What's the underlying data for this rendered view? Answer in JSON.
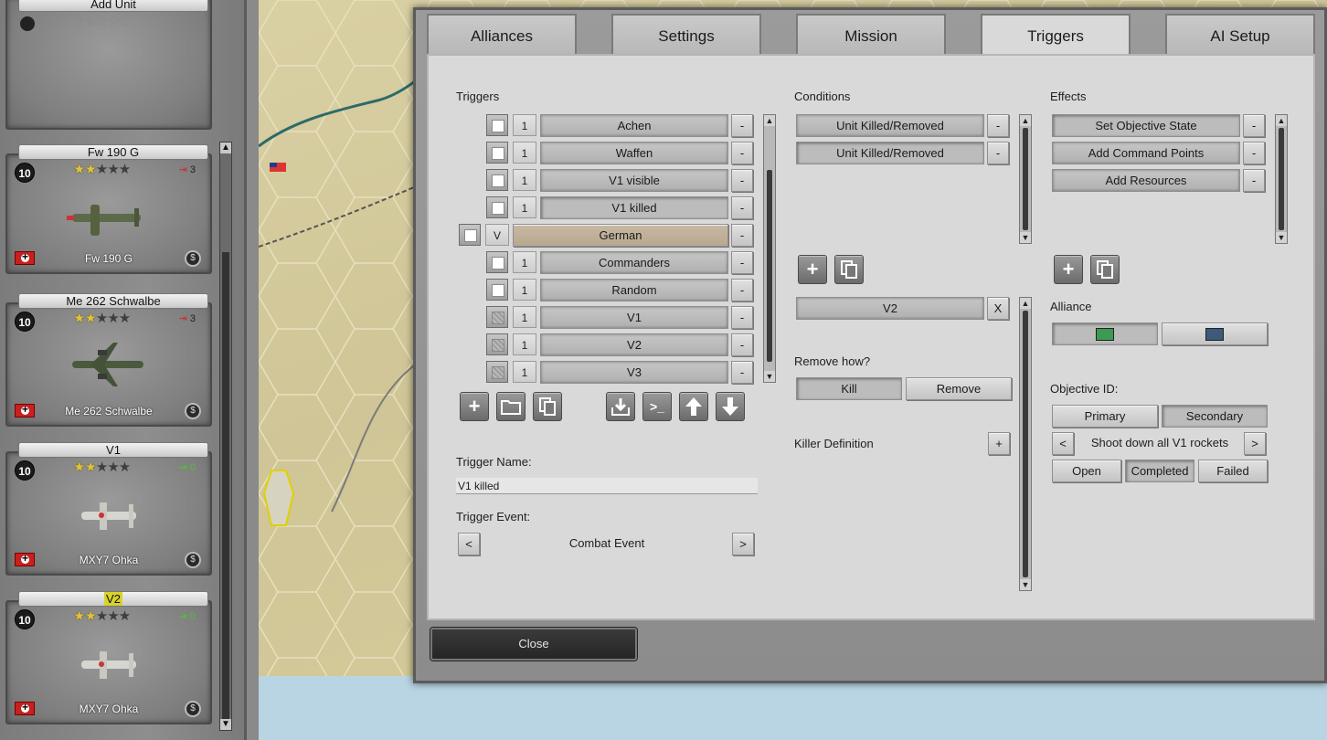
{
  "units": [
    {
      "header": "Add Unit",
      "strength": "",
      "stars_on": 0,
      "stars_total": 5,
      "ammo": "",
      "name": ""
    },
    {
      "header": "Fw 190 G",
      "strength": "10",
      "stars_on": 2,
      "stars_total": 5,
      "ammo": "3",
      "ammo_color": "red",
      "name": "Fw 190 G"
    },
    {
      "header": "Me 262 Schwalbe",
      "strength": "10",
      "stars_on": 2,
      "stars_total": 5,
      "ammo": "3",
      "ammo_color": "red",
      "name": "Me 262 Schwalbe"
    },
    {
      "header": "V1",
      "strength": "10",
      "stars_on": 2,
      "stars_total": 5,
      "ammo": "0",
      "ammo_color": "green",
      "name": "MXY7 Ohka"
    },
    {
      "header": "V2",
      "strength": "10",
      "stars_on": 2,
      "stars_total": 5,
      "ammo": "0",
      "ammo_color": "green",
      "name": "MXY7 Ohka",
      "highlighted": true
    }
  ],
  "tabs": [
    "Alliances",
    "Settings",
    "Mission",
    "Triggers",
    "AI Setup"
  ],
  "active_tab": "Triggers",
  "triggers": {
    "label": "Triggers",
    "items": [
      {
        "num": "1",
        "name": "Achen",
        "checked": true
      },
      {
        "num": "1",
        "name": "Waffen",
        "checked": true
      },
      {
        "num": "1",
        "name": "V1 visible",
        "checked": true
      },
      {
        "num": "1",
        "name": "V1 killed",
        "checked": true,
        "selected": true
      },
      {
        "num": "V",
        "name": "German",
        "group": true,
        "checked": true
      },
      {
        "num": "1",
        "name": "Commanders",
        "checked": true
      },
      {
        "num": "1",
        "name": "Random",
        "checked": true
      },
      {
        "num": "1",
        "name": "V1",
        "checked": false
      },
      {
        "num": "1",
        "name": "V2",
        "checked": false
      },
      {
        "num": "1",
        "name": "V3",
        "checked": false
      }
    ],
    "remove_label": "-",
    "name_label": "Trigger Name:",
    "name_value": "V1 killed",
    "event_label": "Trigger Event:",
    "event_value": "Combat Event",
    "prev": "<",
    "next": ">"
  },
  "conditions": {
    "label": "Conditions",
    "items": [
      "Unit Killed/Removed",
      "Unit Killed/Removed"
    ],
    "remove_label": "-",
    "unit_value": "V2",
    "clear_label": "X",
    "remove_how_label": "Remove how?",
    "kill_label": "Kill",
    "remove_label_btn": "Remove",
    "killer_label": "Killer Definition",
    "add_label": "+"
  },
  "effects": {
    "label": "Effects",
    "items": [
      "Set Objective State",
      "Add Command Points",
      "Add Resources"
    ],
    "remove_label": "-",
    "alliance_label": "Alliance",
    "alliance_colors": [
      "#3c9a52",
      "#3d5a7a"
    ],
    "objective_label": "Objective ID:",
    "primary": "Primary",
    "secondary": "Secondary",
    "objective_prev": "<",
    "objective_next": ">",
    "objective_value": "Shoot down all V1 rockets",
    "open": "Open",
    "completed": "Completed",
    "failed": "Failed"
  },
  "close_label": "Close",
  "icons": {
    "plus": "+",
    "down": "▼",
    "up": "▲"
  }
}
